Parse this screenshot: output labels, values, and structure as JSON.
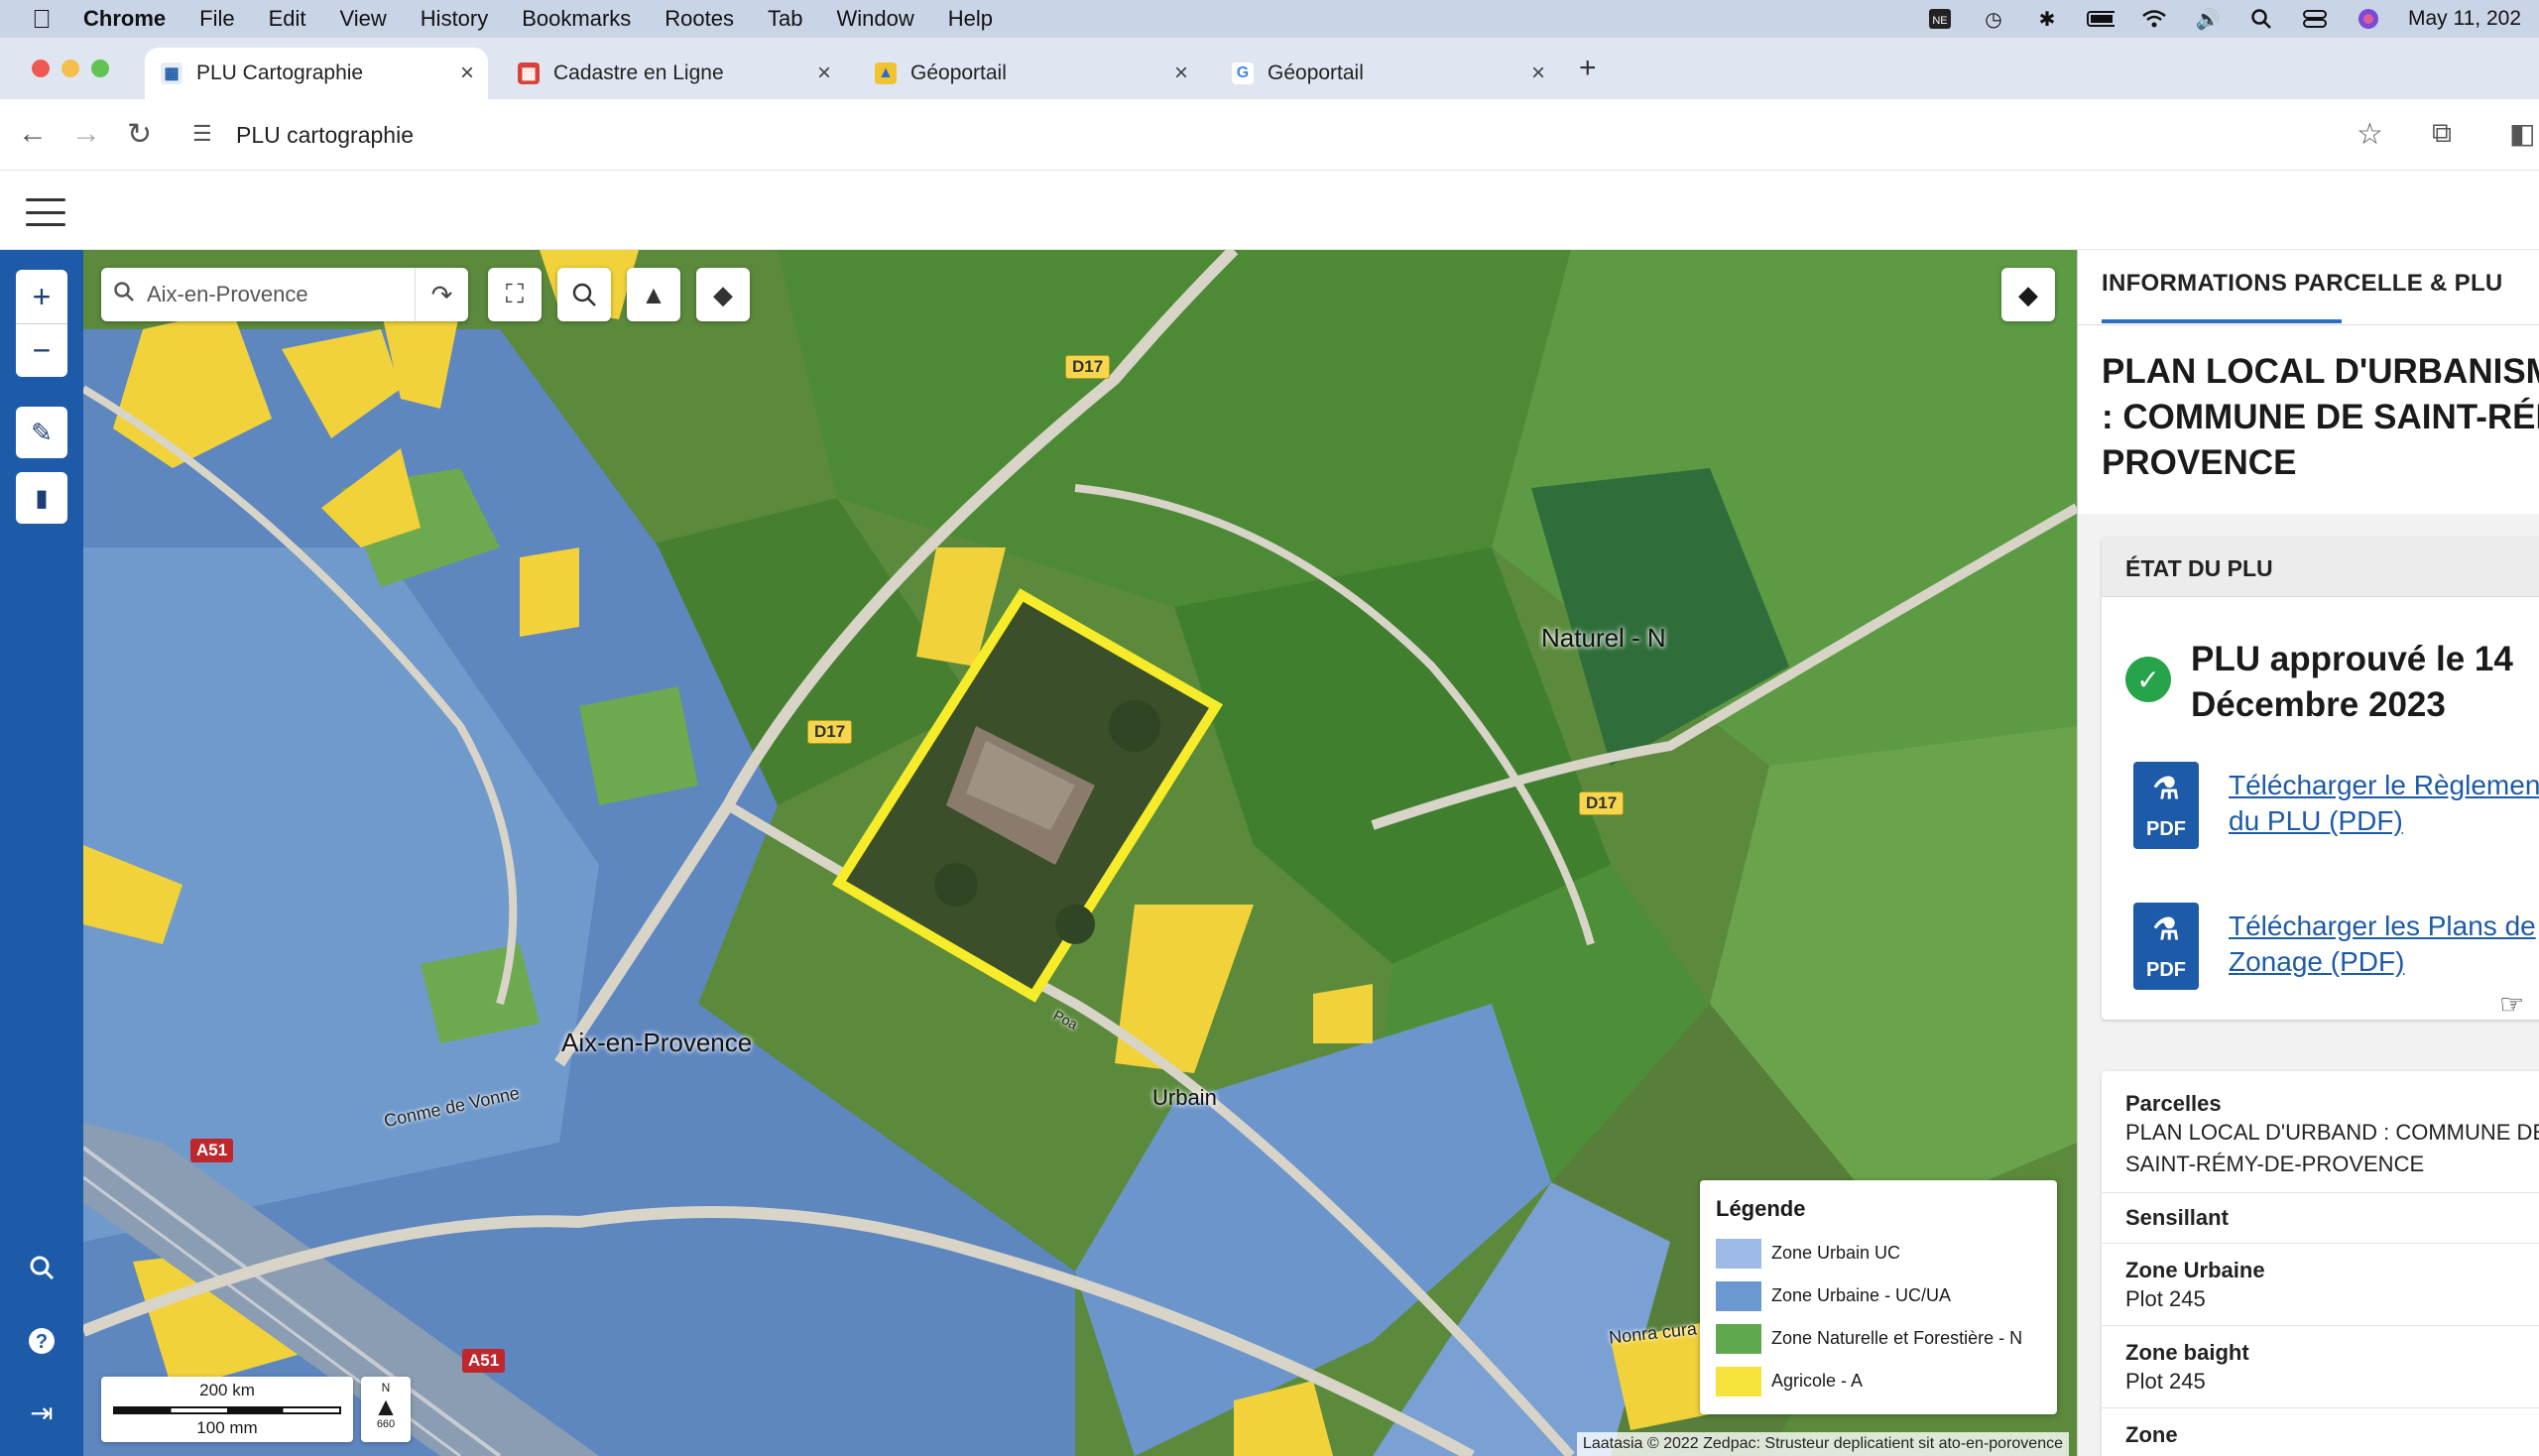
{
  "menubar": {
    "app": "Chrome",
    "items": [
      "File",
      "Edit",
      "View",
      "History",
      "Bookmarks",
      "Rootes",
      "Tab",
      "Window",
      "Help"
    ],
    "date": "May 11, 202"
  },
  "tabs": [
    {
      "label": "PLU Cartographie",
      "active": true
    },
    {
      "label": "Cadastre en Ligne",
      "active": false
    },
    {
      "label": "Géoportail",
      "active": false
    },
    {
      "label": "Géoportail",
      "active": false
    }
  ],
  "address": {
    "url": "PLU cartographie"
  },
  "map": {
    "search": {
      "value": "Aix-en-Provence"
    },
    "labels": {
      "city": "Aix-en-Provence",
      "naturel": "Naturel - N",
      "urbain": "Urbain",
      "road1": "Conme de Vonne",
      "road2": "Nonra cura",
      "road3": "Poa"
    },
    "road_tags": {
      "d17": "D17",
      "a51": "A51"
    },
    "legend": {
      "title": "Légende",
      "items": [
        {
          "label": "Zone Urbain UC",
          "color": "#9dbbe6"
        },
        {
          "label": "Zone Urbaine - UC/UA",
          "color": "#6b98d1"
        },
        {
          "label": "Zone Naturelle et Forestière - N",
          "color": "#5fa84e"
        },
        {
          "label": "Agricole - A",
          "color": "#f6e33c"
        }
      ]
    },
    "scale": {
      "top": "200 km",
      "bottom": "100 mm"
    },
    "north": {
      "letter": "N",
      "value": "660"
    },
    "attribution": "Laatasia © 2022 Zedpac: Strusteur deplicatient sit ato-en-porovence"
  },
  "panel": {
    "tab": "INFORMATIONS PARCELLE & PLU",
    "title": "PLAN LOCAL D'URBANISME (PLU) : COMMUNE DE SAINT-RÉMY-DE-PROVENCE",
    "etat": {
      "header": "ÉTAT DU PLU",
      "status": "PLU approuvé le 14 Décembre 2023",
      "downloads": [
        {
          "label": "Télécharger le Règlement du PLU (PDF)",
          "icon": "PDF"
        },
        {
          "label": "Télécharger les Plans de Zonage (PDF)",
          "icon": "PDF"
        }
      ]
    },
    "info": [
      {
        "key": "Parcelles",
        "value": "PLAN LOCAL D'URBAND : COMMUNE DE SAINT-RÉMY-DE-PROVENCE"
      },
      {
        "key": "Sensillant",
        "value": ""
      },
      {
        "key": "Zone Urbaine",
        "value": "Plot 245"
      },
      {
        "key": "Zone baight",
        "value": "Plot 245"
      },
      {
        "key": "Zone",
        "value": ""
      }
    ]
  }
}
